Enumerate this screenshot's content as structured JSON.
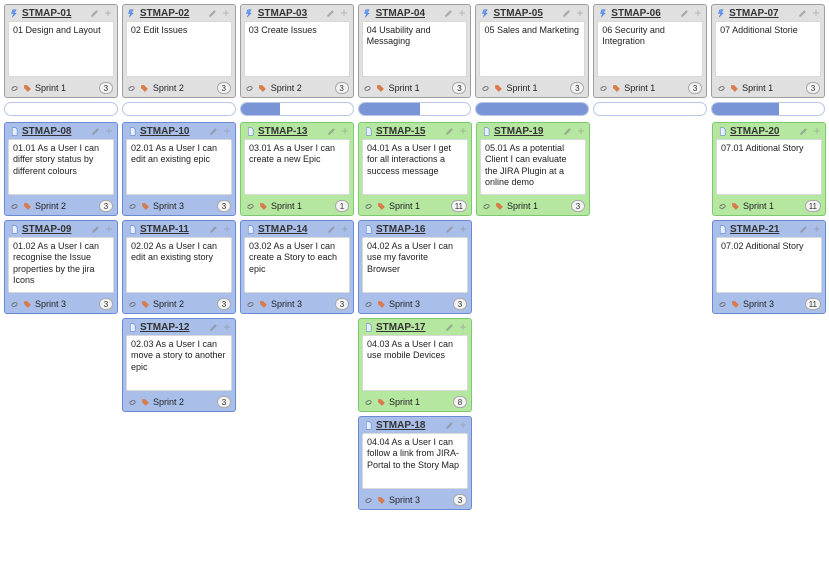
{
  "columns": [
    {
      "header": {
        "key": "STMAP-01",
        "title": "01 Design and Layout",
        "sprint": "Sprint 1",
        "count": 3
      },
      "sepFill": 0,
      "cards": [
        {
          "key": "STMAP-08",
          "color": "blue",
          "text": "01.01 As a User I can differ story status by different colours",
          "sprint": "Sprint 2",
          "count": 3
        },
        {
          "key": "STMAP-09",
          "color": "blue",
          "text": "01.02 As a User I can recognise the Issue properties by the jira Icons",
          "sprint": "Sprint 3",
          "count": 3
        }
      ]
    },
    {
      "header": {
        "key": "STMAP-02",
        "title": "02 Edit Issues",
        "sprint": "Sprint 2",
        "count": 3
      },
      "sepFill": 0,
      "cards": [
        {
          "key": "STMAP-10",
          "color": "blue",
          "text": "02.01 As a User I can edit an existing epic",
          "sprint": "Sprint 3",
          "count": 3
        },
        {
          "key": "STMAP-11",
          "color": "blue",
          "text": "02.02 As a User I can edit an existing story",
          "sprint": "Sprint 2",
          "count": 3
        },
        {
          "key": "STMAP-12",
          "color": "blue",
          "text": "02.03 As a User I can move a story to another epic",
          "sprint": "Sprint 2",
          "count": 3
        }
      ]
    },
    {
      "header": {
        "key": "STMAP-03",
        "title": "03 Create Issues",
        "sprint": "Sprint 2",
        "count": 3
      },
      "sepFill": 35,
      "cards": [
        {
          "key": "STMAP-13",
          "color": "green",
          "text": "03.01 As a User I can create a new Epic",
          "sprint": "Sprint 1",
          "count": 1
        },
        {
          "key": "STMAP-14",
          "color": "blue",
          "text": "03.02 As a User I can create a Story to each epic",
          "sprint": "Sprint 3",
          "count": 3
        }
      ]
    },
    {
      "header": {
        "key": "STMAP-04",
        "title": "04 Usability and Messaging",
        "sprint": "Sprint 1",
        "count": 3
      },
      "sepFill": 55,
      "cards": [
        {
          "key": "STMAP-15",
          "color": "green",
          "text": "04.01 As a User I get for all interactions a success message",
          "sprint": "Sprint 1",
          "count": 11
        },
        {
          "key": "STMAP-16",
          "color": "blue",
          "text": "04.02 As a User I can use my favorite Browser",
          "sprint": "Sprint 3",
          "count": 3
        },
        {
          "key": "STMAP-17",
          "color": "green",
          "text": "04.03 As a User I can use mobile Devices",
          "sprint": "Sprint 1",
          "count": 8
        },
        {
          "key": "STMAP-18",
          "color": "blue",
          "text": "04.04 As a User I can follow a link from JIRA- Portal to the Story Map",
          "sprint": "Sprint 3",
          "count": 3
        }
      ]
    },
    {
      "header": {
        "key": "STMAP-05",
        "title": "05 Sales and Marketing",
        "sprint": "Sprint 1",
        "count": 3
      },
      "sepFill": 100,
      "cards": [
        {
          "key": "STMAP-19",
          "color": "green",
          "text": "05.01 As a potential Client I can evaluate the JIRA Plugin at a online demo",
          "sprint": "Sprint 1",
          "count": 3
        }
      ]
    },
    {
      "header": {
        "key": "STMAP-06",
        "title": "06 Security and Integration",
        "sprint": "Sprint 1",
        "count": 3
      },
      "sepFill": 0,
      "cards": []
    },
    {
      "header": {
        "key": "STMAP-07",
        "title": "07 Additional Storie",
        "sprint": "Sprint 1",
        "count": 3
      },
      "sepFill": 60,
      "cards": [
        {
          "key": "STMAP-20",
          "color": "green",
          "text": "07.01 Aditional Story",
          "sprint": "Sprint 1",
          "count": 11
        },
        {
          "key": "STMAP-21",
          "color": "blue",
          "text": "07.02 Aditional Story",
          "sprint": "Sprint 3",
          "count": 11
        }
      ]
    }
  ]
}
